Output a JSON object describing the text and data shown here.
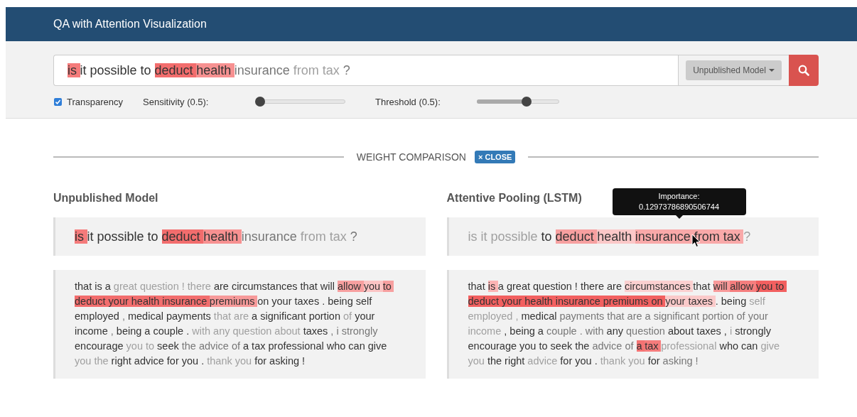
{
  "header": {
    "title": "QA with Attention Visualization"
  },
  "search": {
    "query": [
      {
        "text": "is",
        "color": "#f57b7b",
        "dimmed": false,
        "faint": false
      },
      {
        "text": "it possible to",
        "dimmed": false,
        "faint": false
      },
      {
        "text": "deduct",
        "color": "#f26d6d",
        "dimmed": false,
        "faint": false
      },
      {
        "text": "health",
        "color": "#f79191",
        "dimmed": false,
        "faint": false
      },
      {
        "text": "insurance",
        "dimmed": true,
        "faint": false
      },
      {
        "text": "from tax",
        "dimmed": true,
        "faint": true
      },
      {
        "text": "?",
        "dimmed": true,
        "faint": false
      }
    ],
    "model_dropdown": "Unpublished Model"
  },
  "controls": {
    "transparency": {
      "label": "Transparency",
      "checked": true
    },
    "sensitivity": {
      "label": "Sensitivity (0.5):",
      "level": 0.0
    },
    "threshold": {
      "label": "Threshold (0.5):",
      "level": 0.6
    }
  },
  "comparison": {
    "title": "WEIGHT COMPARISON",
    "close_button": "× CLOSE",
    "panels": [
      {
        "title": "Unpublished Model",
        "question": [
          {
            "text": "is",
            "color": "#f57b7b",
            "dimmed": false,
            "faint": false
          },
          {
            "text": "it possible to",
            "dimmed": false,
            "faint": false
          },
          {
            "text": "deduct",
            "color": "#f26d6d",
            "dimmed": false,
            "faint": false
          },
          {
            "text": "health",
            "color": "#f79191",
            "dimmed": false,
            "faint": false
          },
          {
            "text": "insurance",
            "dimmed": true,
            "faint": false
          },
          {
            "text": "from tax",
            "dimmed": true,
            "faint": true
          },
          {
            "text": "?",
            "dimmed": true,
            "faint": false
          }
        ],
        "answer_lines": [
          [
            {
              "text": "that is a",
              "dimmed": false,
              "faint": false
            },
            {
              "text": "great question ! there",
              "dimmed": true,
              "faint": true
            },
            {
              "text": "are circumstances that will",
              "dimmed": false,
              "faint": false
            },
            {
              "text": "allow",
              "color": "#f7a0a0",
              "dimmed": false,
              "faint": false
            },
            {
              "text": "you",
              "color": "#fbc4c4",
              "dimmed": false,
              "faint": false
            },
            {
              "text": "to",
              "color": "#f7a0a0",
              "dimmed": false,
              "faint": false
            }
          ],
          [
            {
              "text": "deduct your health insurance",
              "color": "#f26d6d",
              "dimmed": false,
              "faint": false
            },
            {
              "text": "premiums",
              "color": "#f79a9a",
              "dimmed": false,
              "faint": false
            },
            {
              "text": "on your taxes . being self",
              "dimmed": false,
              "faint": false
            }
          ],
          [
            {
              "text": "employed",
              "dimmed": false,
              "faint": false
            },
            {
              "text": ",",
              "dimmed": true,
              "faint": false
            },
            {
              "text": "medical payments",
              "dimmed": false,
              "faint": false
            },
            {
              "text": "that are",
              "dimmed": true,
              "faint": true
            },
            {
              "text": "a significant portion",
              "dimmed": false,
              "faint": false
            },
            {
              "text": "of",
              "dimmed": true,
              "faint": true
            },
            {
              "text": "your",
              "dimmed": false,
              "faint": false
            }
          ],
          [
            {
              "text": "income",
              "dimmed": false,
              "faint": false
            },
            {
              "text": ",",
              "dimmed": true,
              "faint": false
            },
            {
              "text": "being a couple .",
              "dimmed": false,
              "faint": false
            },
            {
              "text": "with any question about",
              "dimmed": true,
              "faint": true
            },
            {
              "text": "taxes",
              "dimmed": false,
              "faint": false
            },
            {
              "text": ", i strongly",
              "dimmed": true,
              "faint": false
            }
          ],
          [
            {
              "text": "encourage",
              "dimmed": false,
              "faint": false
            },
            {
              "text": "you to",
              "dimmed": true,
              "faint": true
            },
            {
              "text": "seek",
              "dimmed": false,
              "faint": false
            },
            {
              "text": "the advice of",
              "dimmed": true,
              "faint": false
            },
            {
              "text": "a tax professional who can give",
              "dimmed": false,
              "faint": false
            }
          ],
          [
            {
              "text": "you the",
              "dimmed": true,
              "faint": true
            },
            {
              "text": "right advice for you .",
              "dimmed": false,
              "faint": false
            },
            {
              "text": "thank you",
              "dimmed": true,
              "faint": true
            },
            {
              "text": "for asking !",
              "dimmed": false,
              "faint": false
            }
          ]
        ]
      },
      {
        "title": "Attentive Pooling (LSTM)",
        "tooltip": {
          "title": "Importance:",
          "value": "0.12973786890506744"
        },
        "question": [
          {
            "text": "is it possible",
            "dimmed": true,
            "faint": true
          },
          {
            "text": "to",
            "dimmed": false,
            "faint": false
          },
          {
            "text": "deduct",
            "color": "#f7a0a0",
            "dimmed": false,
            "faint": false
          },
          {
            "text": "health",
            "color": "#fbc8c8",
            "dimmed": false,
            "faint": false
          },
          {
            "text": "insurance from tax",
            "color": "#f9a9a9",
            "dimmed": false,
            "faint": false
          },
          {
            "text": "?",
            "dimmed": true,
            "faint": true
          }
        ],
        "answer_lines": [
          [
            {
              "text": "that",
              "dimmed": false,
              "faint": false
            },
            {
              "text": "is",
              "color": "#fbb4b4",
              "dimmed": false,
              "faint": false
            },
            {
              "text": "a great question ! there are",
              "dimmed": false,
              "faint": false
            },
            {
              "text": "circumstances",
              "color": "#fbd0d0",
              "dimmed": false,
              "faint": false
            },
            {
              "text": "that",
              "dimmed": false,
              "faint": false
            },
            {
              "text": "will",
              "color": "#f89a9a",
              "dimmed": false,
              "faint": false
            },
            {
              "text": "allow",
              "color": "#f57e7e",
              "dimmed": false,
              "faint": false
            },
            {
              "text": "you to",
              "color": "#f26060",
              "dimmed": false,
              "faint": false
            }
          ],
          [
            {
              "text": "deduct your health insurance premiums on",
              "color": "#f26060",
              "dimmed": false,
              "faint": false
            },
            {
              "text": "your taxes",
              "color": "#fbcaca",
              "dimmed": false,
              "faint": false
            },
            {
              "text": ". being",
              "dimmed": false,
              "faint": false
            },
            {
              "text": "self",
              "dimmed": true,
              "faint": true
            }
          ],
          [
            {
              "text": "employed ,",
              "dimmed": true,
              "faint": true
            },
            {
              "text": "medical",
              "dimmed": false,
              "faint": false
            },
            {
              "text": "payments that are a significant portion of your",
              "dimmed": true,
              "faint": false
            }
          ],
          [
            {
              "text": "income",
              "dimmed": true,
              "faint": true
            },
            {
              "text": ", being a",
              "dimmed": false,
              "faint": false
            },
            {
              "text": "couple . with",
              "dimmed": true,
              "faint": false
            },
            {
              "text": "any",
              "dimmed": false,
              "faint": false
            },
            {
              "text": "question",
              "dimmed": true,
              "faint": false
            },
            {
              "text": "about taxes ,",
              "dimmed": false,
              "faint": false
            },
            {
              "text": "i",
              "dimmed": true,
              "faint": true
            },
            {
              "text": "strongly",
              "dimmed": false,
              "faint": false
            }
          ],
          [
            {
              "text": "encourage you to seek the",
              "dimmed": false,
              "faint": false
            },
            {
              "text": "advice of",
              "dimmed": true,
              "faint": false
            },
            {
              "text": "a",
              "color": "#f47373",
              "dimmed": false,
              "faint": false
            },
            {
              "text": "tax",
              "color": "#f57c7c",
              "dimmed": false,
              "faint": false
            },
            {
              "text": "professional",
              "dimmed": true,
              "faint": true
            },
            {
              "text": "who can",
              "dimmed": false,
              "faint": false
            },
            {
              "text": "give",
              "dimmed": true,
              "faint": true
            }
          ],
          [
            {
              "text": "you",
              "dimmed": true,
              "faint": true
            },
            {
              "text": "the right",
              "dimmed": false,
              "faint": false
            },
            {
              "text": "advice",
              "dimmed": true,
              "faint": true
            },
            {
              "text": "for you .",
              "dimmed": false,
              "faint": false
            },
            {
              "text": "thank you",
              "dimmed": true,
              "faint": true
            },
            {
              "text": "for",
              "dimmed": false,
              "faint": false
            },
            {
              "text": "asking !",
              "dimmed": true,
              "faint": false
            }
          ]
        ]
      }
    ]
  }
}
